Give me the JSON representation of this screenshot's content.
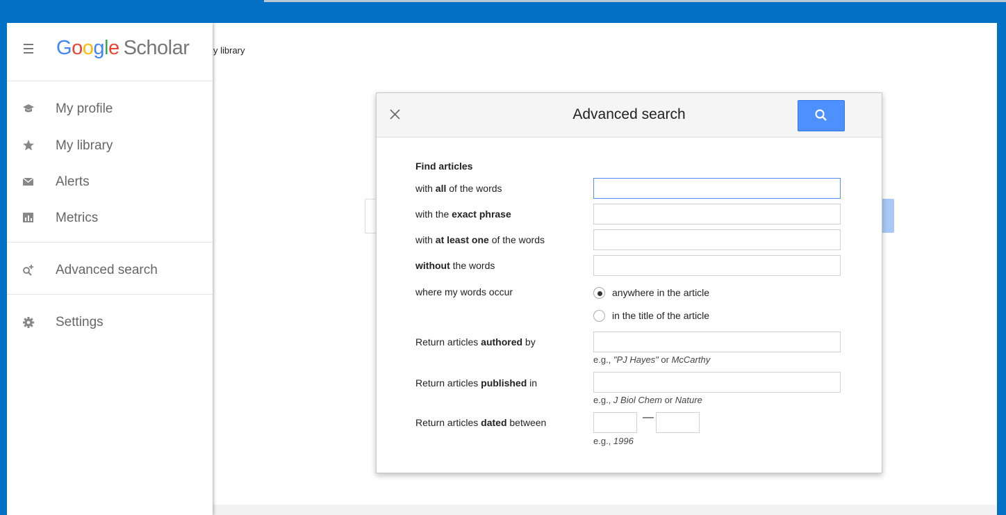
{
  "drawer": {
    "logo": {
      "G1": "G",
      "o1": "o",
      "o2": "o",
      "g": "g",
      "l": "l",
      "e": "e",
      "product": "Scholar"
    },
    "items": [
      {
        "label": "My profile",
        "icon": "graduation-cap-icon"
      },
      {
        "label": "My library",
        "icon": "star-icon"
      },
      {
        "label": "Alerts",
        "icon": "envelope-icon"
      },
      {
        "label": "Metrics",
        "icon": "bar-chart-icon"
      },
      {
        "label": "Advanced search",
        "icon": "search-plus-icon"
      },
      {
        "label": "Settings",
        "icon": "gear-icon"
      }
    ]
  },
  "background": {
    "partial_link": "y library"
  },
  "dialog": {
    "title": "Advanced search",
    "heading": "Find articles",
    "rows": {
      "all": {
        "pre": "with ",
        "bold": "all",
        "post": " of the words",
        "value": ""
      },
      "exact": {
        "pre": "with the ",
        "bold": "exact phrase",
        "post": "",
        "value": ""
      },
      "atleast": {
        "pre": "with ",
        "bold": "at least one",
        "post": " of the words",
        "value": ""
      },
      "without": {
        "pre": "",
        "bold": "without",
        "post": " the words",
        "value": ""
      },
      "occur": {
        "label": "where my words occur"
      },
      "author": {
        "pre": "Return articles ",
        "bold": "authored",
        "post": " by",
        "value": ""
      },
      "published": {
        "pre": "Return articles ",
        "bold": "published",
        "post": " in",
        "value": ""
      },
      "dated": {
        "pre": "Return articles ",
        "bold": "dated",
        "post": " between",
        "from": "",
        "to": ""
      }
    },
    "radio_options": [
      {
        "label": "anywhere in the article",
        "selected": true
      },
      {
        "label": "in the title of the article",
        "selected": false
      }
    ],
    "hints": {
      "author": {
        "pre": "e.g., ",
        "ex1": "\"PJ Hayes\"",
        "mid": " or ",
        "ex2": "McCarthy"
      },
      "published": {
        "pre": "e.g., ",
        "ex1": "J Biol Chem",
        "mid": " or ",
        "ex2": "Nature"
      },
      "dated": {
        "pre": "e.g., ",
        "ex1": "1996"
      }
    },
    "date_separator": "—"
  },
  "colors": {
    "frame_blue": "#0270c4",
    "accent_blue": "#4d90fe",
    "focus_border": "#4d90fe"
  }
}
